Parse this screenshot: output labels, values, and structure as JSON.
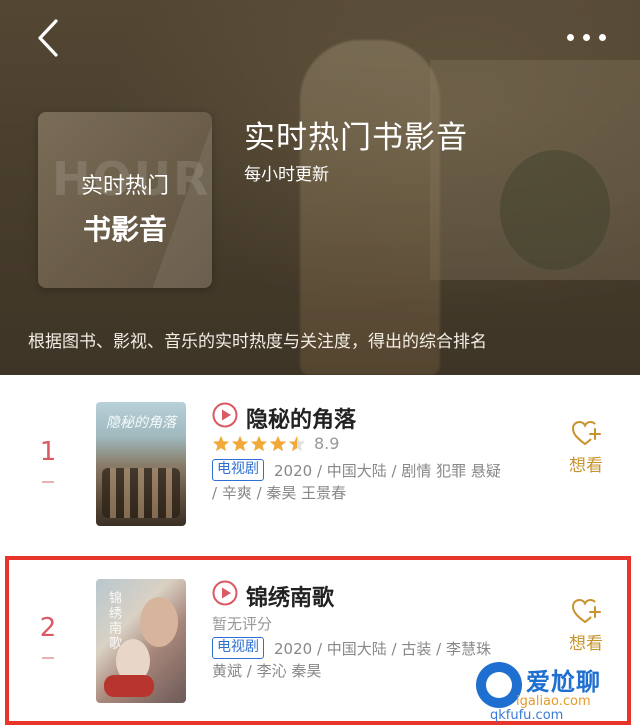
{
  "header": {
    "cover_line1": "实时热门",
    "cover_line2": "书影音",
    "cover_watermark": "HOUR",
    "title": "实时热门书影音",
    "subtitle": "每小时更新",
    "description": "根据图书、影视、音乐的实时热度与关注度，得出的综合排名",
    "back_icon": "chevron-left-icon",
    "more_icon": "more-dots-icon"
  },
  "items": [
    {
      "rank": "1",
      "title": "隐秘的角落",
      "poster_text": "隐秘的角落",
      "stars": 4.5,
      "rating": "8.9",
      "tag": "电视剧",
      "meta_line1": "2020 / 中国大陆 / 剧情 犯罪 悬疑",
      "meta_line2": "/ 辛爽 / 秦昊 王景春",
      "want_label": "想看"
    },
    {
      "rank": "2",
      "title": "锦绣南歌",
      "poster_text": "锦绣南歌",
      "rating_text": "暂无评分",
      "tag": "电视剧",
      "meta_line1": "2020 / 中国大陆 / 古装 / 李慧珠",
      "meta_line2": "黄斌 / 李沁 秦昊",
      "want_label": "想看"
    }
  ],
  "watermark": {
    "text": "爱尬聊",
    "site": "igaliao.com",
    "site2": "qkfufu.com"
  },
  "colors": {
    "accent_red": "#e8342b",
    "star": "#f1a93a",
    "tag_blue": "#2f6fd1",
    "want_gold": "#c9932e",
    "rank_pink": "#d95a62"
  }
}
